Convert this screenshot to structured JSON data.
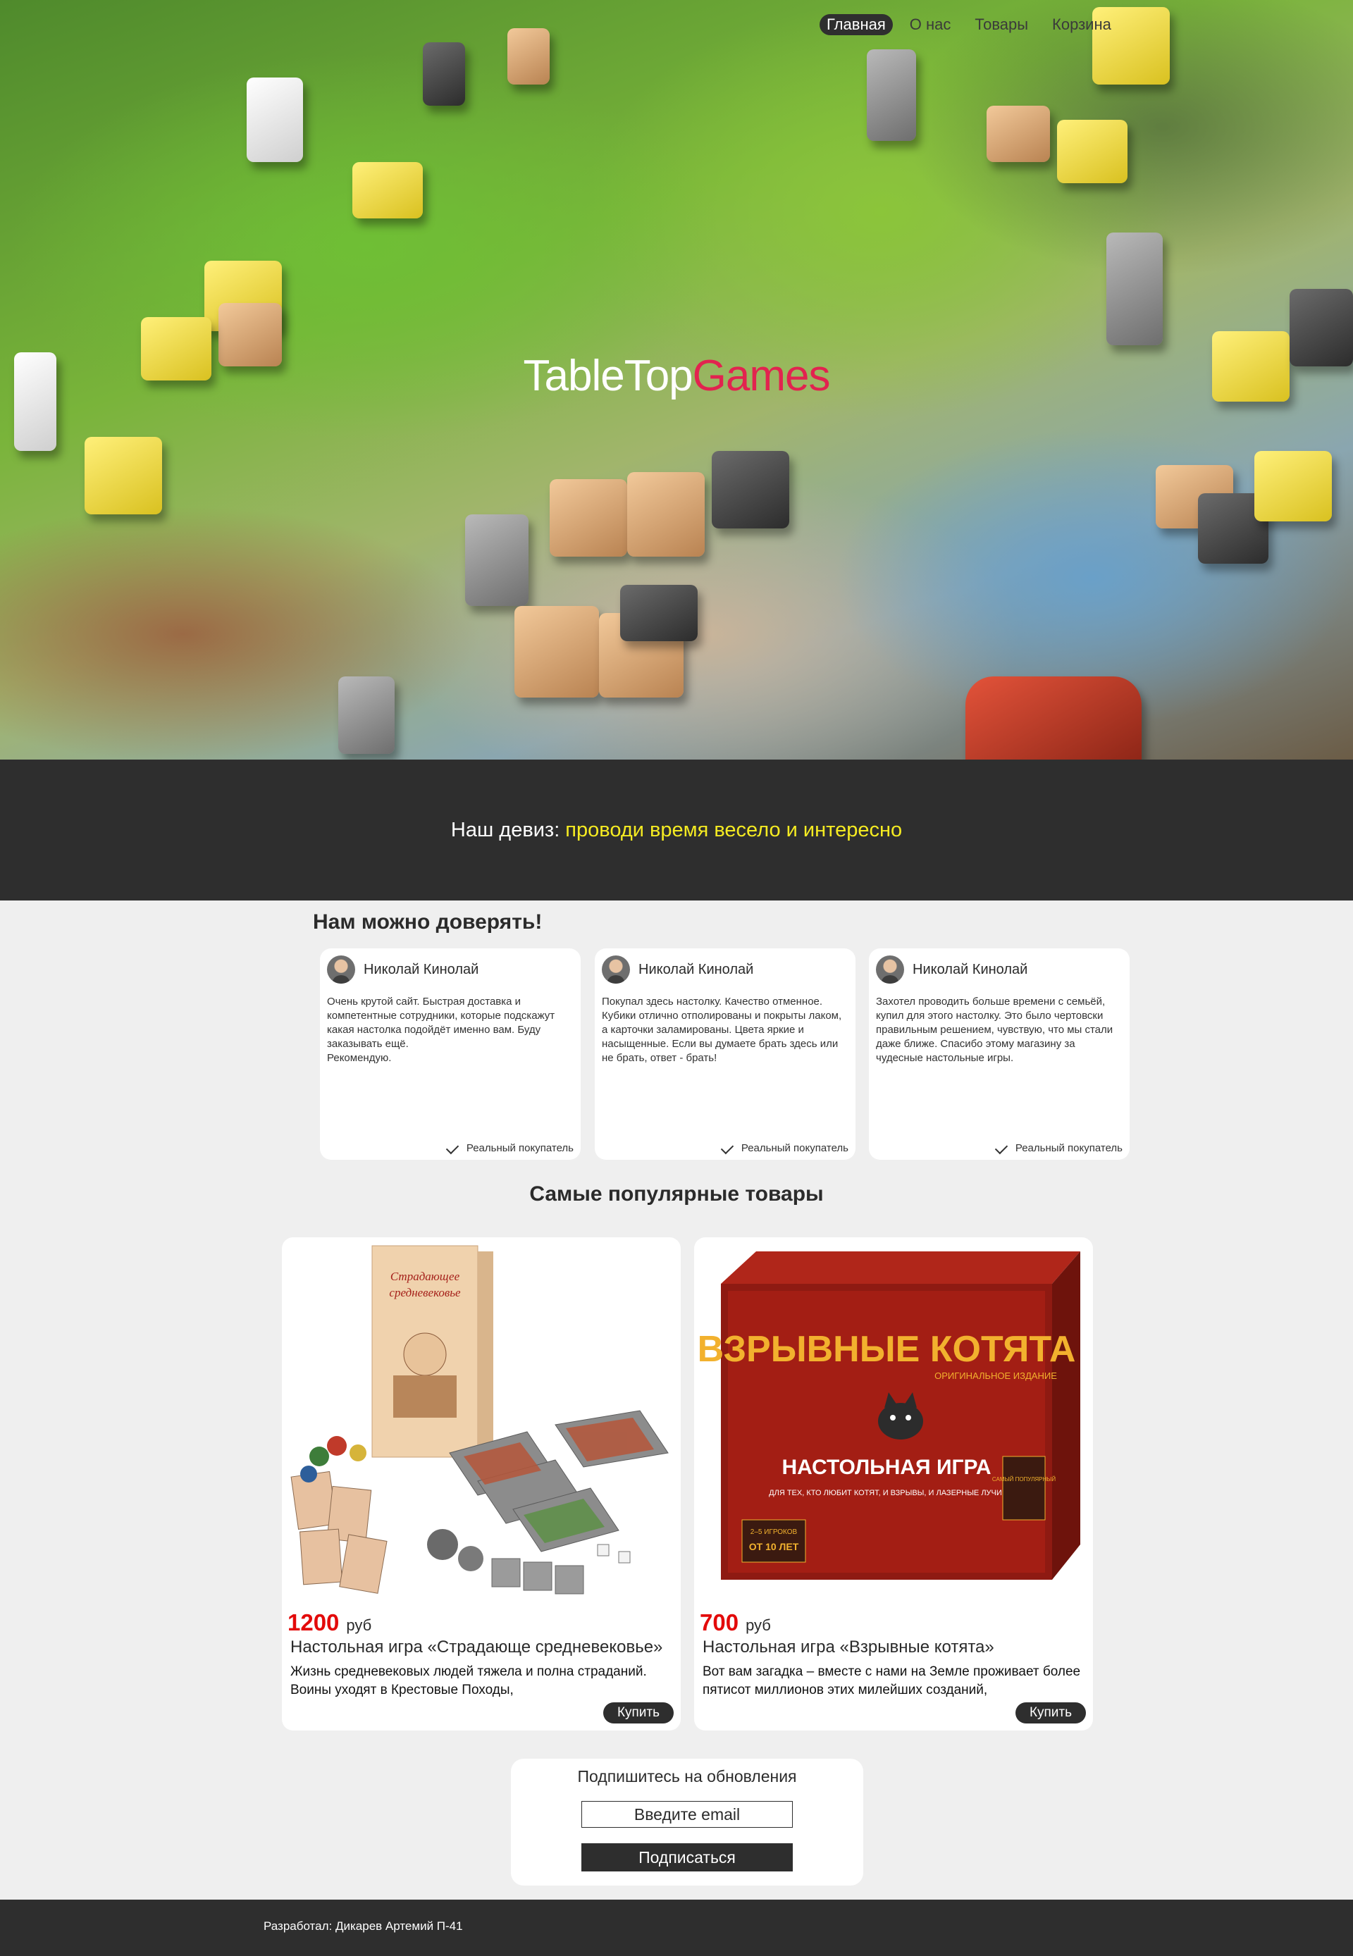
{
  "nav": {
    "items": [
      "Главная",
      "О нас",
      "Товары",
      "Корзина"
    ],
    "active": "Главная"
  },
  "hero": {
    "logo_part1": "TableTop",
    "logo_part2": "Games"
  },
  "motto": {
    "label": "Наш девиз:",
    "text": "проводи время весело и интересно"
  },
  "trust": {
    "title": "Нам можно доверять!",
    "reviews": [
      {
        "name": "Николай Кинолай",
        "text": "Очень крутой сайт. Быстрая доставка и компетентные сотрудники, которые подскажут какая настолка подойдёт именно вам. Буду заказывать ещё.\nРекомендую.",
        "badge": "Реальный покупатель"
      },
      {
        "name": "Николай Кинолай",
        "text": "Покупал здесь настолку. Качество отменное. Кубики отлично отполированы и покрыты лаком, а карточки заламированы. Цвета яркие и насыщенные. Если вы думаете брать здесь или не брать, ответ - брать!",
        "badge": "Реальный покупатель"
      },
      {
        "name": "Николай Кинолай",
        "text": "Захотел проводить больше времени с семьёй, купил для этого настолку. Это было чертовски правильным решением, чувствую, что мы стали даже ближе. Спасибо этому магазину за чудесные настольные игры.",
        "badge": "Реальный покупатель"
      }
    ]
  },
  "popular": {
    "title": "Самые популярные товары",
    "products": [
      {
        "price": "1200",
        "currency": "руб",
        "name": "Настольная игра «Страдающе средневековье»",
        "description": "Жизнь средневековых людей тяжела и полна страданий. Воины уходят в Крестовые Походы,",
        "buy_label": "Купить",
        "box_title": "Страдающее средневековье"
      },
      {
        "price": "700",
        "currency": "руб",
        "name": "Настольная игра «Взрывные котята»",
        "description": "Вот вам загадка – вместе с нами на Земле проживает более пятисот миллионов этих милейших созданий,",
        "buy_label": "Купить",
        "box_title": "ВЗРЫВНЫЕ КОТЯТА",
        "box_subtitle": "ОРИГИНАЛЬНОЕ ИЗДАНИЕ",
        "box_tagline": "НАСТОЛЬНАЯ ИГРА",
        "box_tagline2": "ДЛЯ ТЕХ, КТО ЛЮБИТ КОТЯТ, И ВЗРЫВЫ, И ЛАЗЕРНЫЕ ЛУЧИ,",
        "box_players": "2–5 ИГРОКОВ",
        "box_age": "ОТ 10 ЛЕТ",
        "box_badge": "САМЫЙ ПОПУЛЯРНЫЙ"
      }
    ]
  },
  "subscribe": {
    "title": "Подпишитесь на обновления",
    "placeholder": "Введите email",
    "button": "Подписаться"
  },
  "footer": {
    "text": "Разработал: Дикарев Артемий П-41"
  },
  "colors": {
    "dark": "#2e2e2e",
    "accent_red": "#e2234f",
    "price_red": "#e30a0a",
    "motto_yellow": "#f5eb22",
    "page_bg": "#efefef"
  }
}
